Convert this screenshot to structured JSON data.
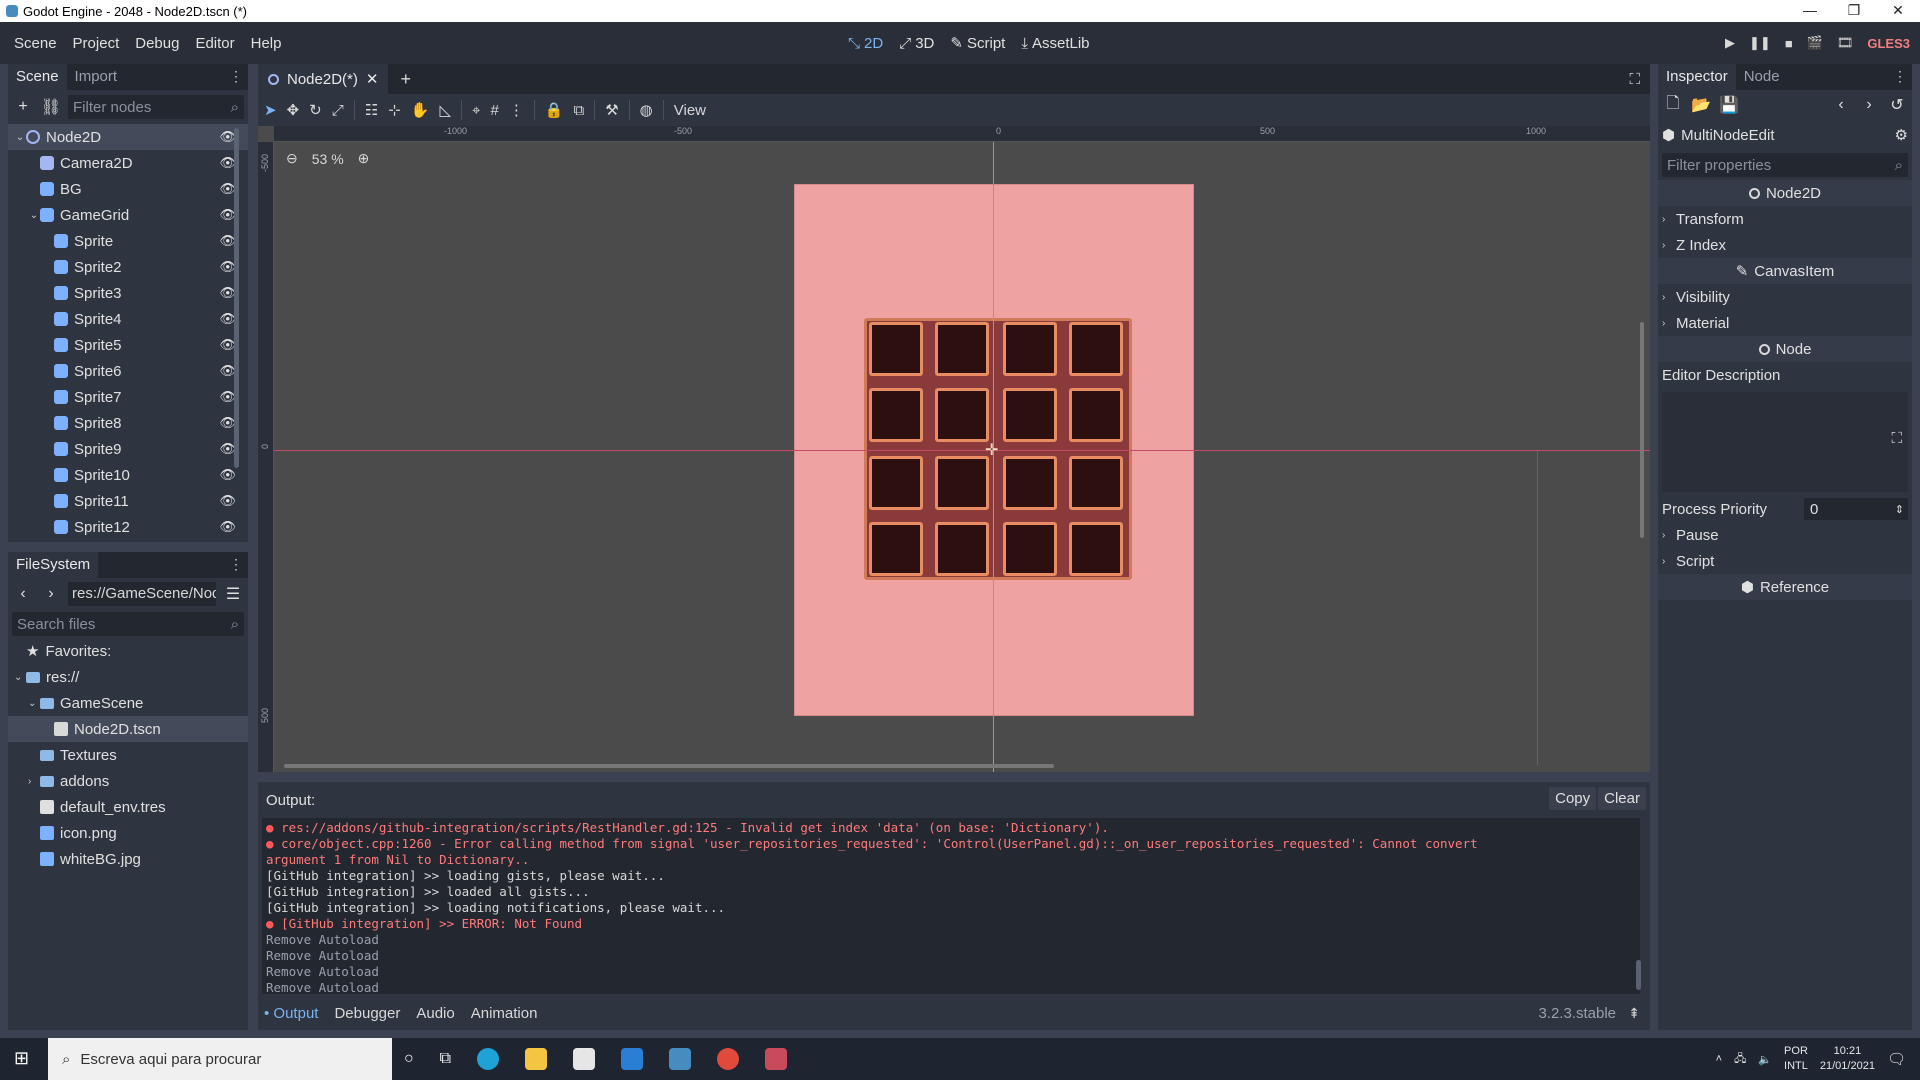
{
  "window": {
    "title": "Godot Engine - 2048 - Node2D.tscn (*)",
    "controls": [
      "—",
      "❐",
      "✕"
    ]
  },
  "menu": [
    "Scene",
    "Project",
    "Debug",
    "Editor",
    "Help"
  ],
  "workspaces": [
    {
      "label": "2D",
      "icon": "2d-icon"
    },
    {
      "label": "3D",
      "icon": "3d-icon"
    },
    {
      "label": "Script",
      "icon": "script-icon"
    },
    {
      "label": "AssetLib",
      "icon": "assetlib-icon"
    }
  ],
  "renderer": "GLES3",
  "scene_dock": {
    "tabs": [
      "Scene",
      "Import"
    ],
    "filter_placeholder": "Filter nodes",
    "nodes": [
      {
        "label": "Node2D",
        "type": "node2d",
        "depth": 0,
        "expanded": true,
        "selected": true
      },
      {
        "label": "Camera2D",
        "type": "cam",
        "depth": 1
      },
      {
        "label": "BG",
        "type": "sprite",
        "depth": 1
      },
      {
        "label": "GameGrid",
        "type": "sprite",
        "depth": 1,
        "expanded": true
      },
      {
        "label": "Sprite",
        "type": "sprite",
        "depth": 2
      },
      {
        "label": "Sprite2",
        "type": "sprite",
        "depth": 2
      },
      {
        "label": "Sprite3",
        "type": "sprite",
        "depth": 2
      },
      {
        "label": "Sprite4",
        "type": "sprite",
        "depth": 2
      },
      {
        "label": "Sprite5",
        "type": "sprite",
        "depth": 2
      },
      {
        "label": "Sprite6",
        "type": "sprite",
        "depth": 2
      },
      {
        "label": "Sprite7",
        "type": "sprite",
        "depth": 2
      },
      {
        "label": "Sprite8",
        "type": "sprite",
        "depth": 2
      },
      {
        "label": "Sprite9",
        "type": "sprite",
        "depth": 2
      },
      {
        "label": "Sprite10",
        "type": "sprite",
        "depth": 2
      },
      {
        "label": "Sprite11",
        "type": "sprite",
        "depth": 2
      },
      {
        "label": "Sprite12",
        "type": "sprite",
        "depth": 2
      }
    ]
  },
  "filesystem": {
    "tab": "FileSystem",
    "path": "res://GameScene/Nod",
    "search_placeholder": "Search files",
    "favorites": "Favorites:",
    "items": [
      {
        "label": "res://",
        "kind": "folder",
        "depth": 0,
        "expanded": true
      },
      {
        "label": "GameScene",
        "kind": "folder",
        "depth": 1,
        "expanded": true
      },
      {
        "label": "Node2D.tscn",
        "kind": "scene",
        "depth": 2,
        "selected": true
      },
      {
        "label": "Textures",
        "kind": "folder",
        "depth": 1
      },
      {
        "label": "addons",
        "kind": "folder",
        "depth": 1,
        "collapsed": true
      },
      {
        "label": "default_env.tres",
        "kind": "resource",
        "depth": 1
      },
      {
        "label": "icon.png",
        "kind": "image",
        "depth": 1
      },
      {
        "label": "whiteBG.jpg",
        "kind": "image",
        "depth": 1
      }
    ]
  },
  "scene_tab": {
    "label": "Node2D(*)"
  },
  "viewport": {
    "view_menu": "View",
    "zoom": "53 %",
    "ruler_h": [
      "-1000",
      "-500",
      "0",
      "500",
      "1000"
    ],
    "ruler_v": [
      "-500",
      "0",
      "500"
    ],
    "grid_rows": 4,
    "grid_cols": 4
  },
  "output": {
    "label": "Output:",
    "copy": "Copy",
    "clear": "Clear",
    "lines": [
      {
        "kind": "err",
        "text": "res://addons/github-integration/scripts/RestHandler.gd:125 - Invalid get index 'data' (on base: 'Dictionary')."
      },
      {
        "kind": "err",
        "text": "core/object.cpp:1260 - Error calling method from signal 'user_repositories_requested': 'Control(UserPanel.gd)::_on_user_repositories_requested': Cannot convert"
      },
      {
        "kind": "errc",
        "text": "argument 1 from Nil to Dictionary.."
      },
      {
        "kind": "info",
        "text": "[GitHub integration] >> loading gists, please wait..."
      },
      {
        "kind": "info",
        "text": "[GitHub integration] >> loaded all gists..."
      },
      {
        "kind": "info",
        "text": "[GitHub integration] >> loading notifications, please wait..."
      },
      {
        "kind": "err",
        "text": "[GitHub integration] >> ERROR: Not Found"
      },
      {
        "kind": "muted",
        "text": "Remove Autoload"
      },
      {
        "kind": "muted",
        "text": "Remove Autoload"
      },
      {
        "kind": "muted",
        "text": "Remove Autoload"
      },
      {
        "kind": "muted",
        "text": "Remove Autoload"
      }
    ],
    "tabs": [
      "Output",
      "Debugger",
      "Audio",
      "Animation"
    ],
    "version": "3.2.3.stable"
  },
  "inspector": {
    "tabs": [
      "Inspector",
      "Node"
    ],
    "object": "MultiNodeEdit",
    "filter_placeholder": "Filter properties",
    "node2d_header": "Node2D",
    "node2d_groups": [
      "Transform",
      "Z Index"
    ],
    "canvasitem_header": "CanvasItem",
    "canvasitem_groups": [
      "Visibility",
      "Material"
    ],
    "node_header": "Node",
    "editor_description": "Editor Description",
    "process_priority_label": "Process Priority",
    "process_priority_value": "0",
    "node_groups": [
      "Pause",
      "Script"
    ],
    "reference": "Reference"
  },
  "taskbar": {
    "search_placeholder": "Escreva aqui para procurar",
    "lang_top": "POR",
    "lang_bot": "INTL",
    "time": "10:21",
    "date": "21/01/2021"
  }
}
